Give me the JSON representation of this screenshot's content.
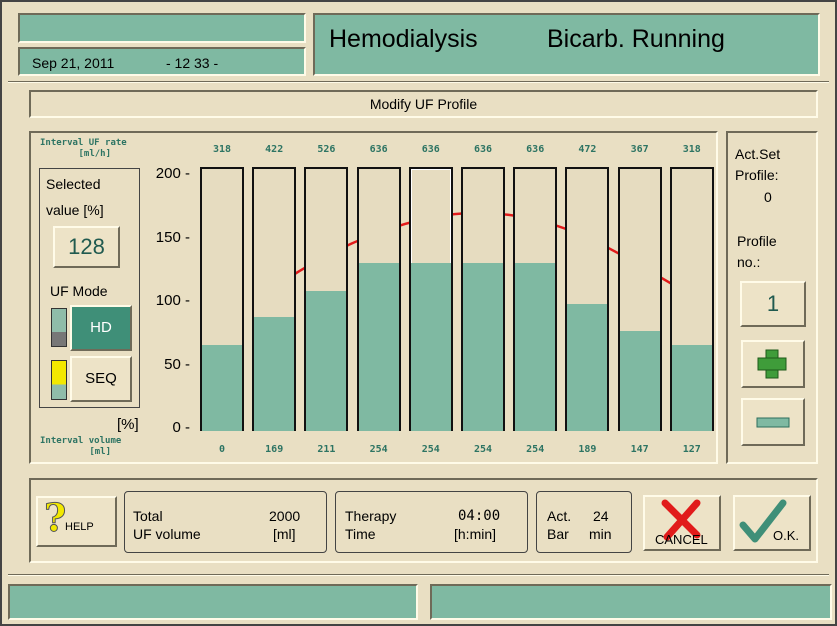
{
  "header": {
    "date": "Sep 21, 2011",
    "time": "- 12 33 -",
    "mode": "Hemodialysis",
    "status": "Bicarb. Running"
  },
  "panel_title": "Modify UF Profile",
  "left_panel": {
    "rate_label_line1": "Interval UF rate",
    "rate_label_line2": "[ml/h]",
    "selected_label_line1": "Selected",
    "selected_label_line2": "value [%]",
    "selected_value": "128",
    "uf_mode_label": "UF Mode",
    "hd_button": "HD",
    "seq_button": "SEQ",
    "percent_label": "[%]",
    "volume_label_line1": "Interval volume",
    "volume_label_line2": "[ml]"
  },
  "chart_data": {
    "type": "bar",
    "ylim": [
      0,
      200
    ],
    "yticks": [
      "200 -",
      "150 -",
      "100 -",
      "50 -",
      "0 -"
    ],
    "values_percent": [
      68,
      90,
      110,
      132,
      132,
      132,
      132,
      100,
      79,
      68
    ],
    "rates": [
      "318",
      "422",
      "526",
      "636",
      "636",
      "636",
      "636",
      "472",
      "367",
      "318"
    ],
    "volumes": [
      "0",
      "169",
      "211",
      "254",
      "254",
      "254",
      "254",
      "189",
      "147",
      "127"
    ],
    "selected_index": 4
  },
  "right_panel": {
    "act_set_line1": "Act.Set",
    "act_set_line2": "Profile:",
    "act_set_value": "0",
    "profile_line1": "Profile",
    "profile_line2": "no.:",
    "profile_value": "1"
  },
  "footer": {
    "help_label": "HELP",
    "total_line1": "Total",
    "total_line2": "UF volume",
    "total_value": "2000",
    "total_unit": "[ml]",
    "therapy_line1": "Therapy",
    "therapy_line2": "Time",
    "therapy_value": "04:00",
    "therapy_unit": "[h:min]",
    "act_line1": "Act.",
    "act_line2": "Bar",
    "act_value": "24",
    "act_unit": "min",
    "cancel_label": "CANCEL",
    "ok_label": "O.K."
  },
  "colors": {
    "accent_green": "#7fb9a2",
    "background": "#e9dfc3",
    "arrow_red": "#e11b1b",
    "plus_green": "#3f9c3a"
  }
}
